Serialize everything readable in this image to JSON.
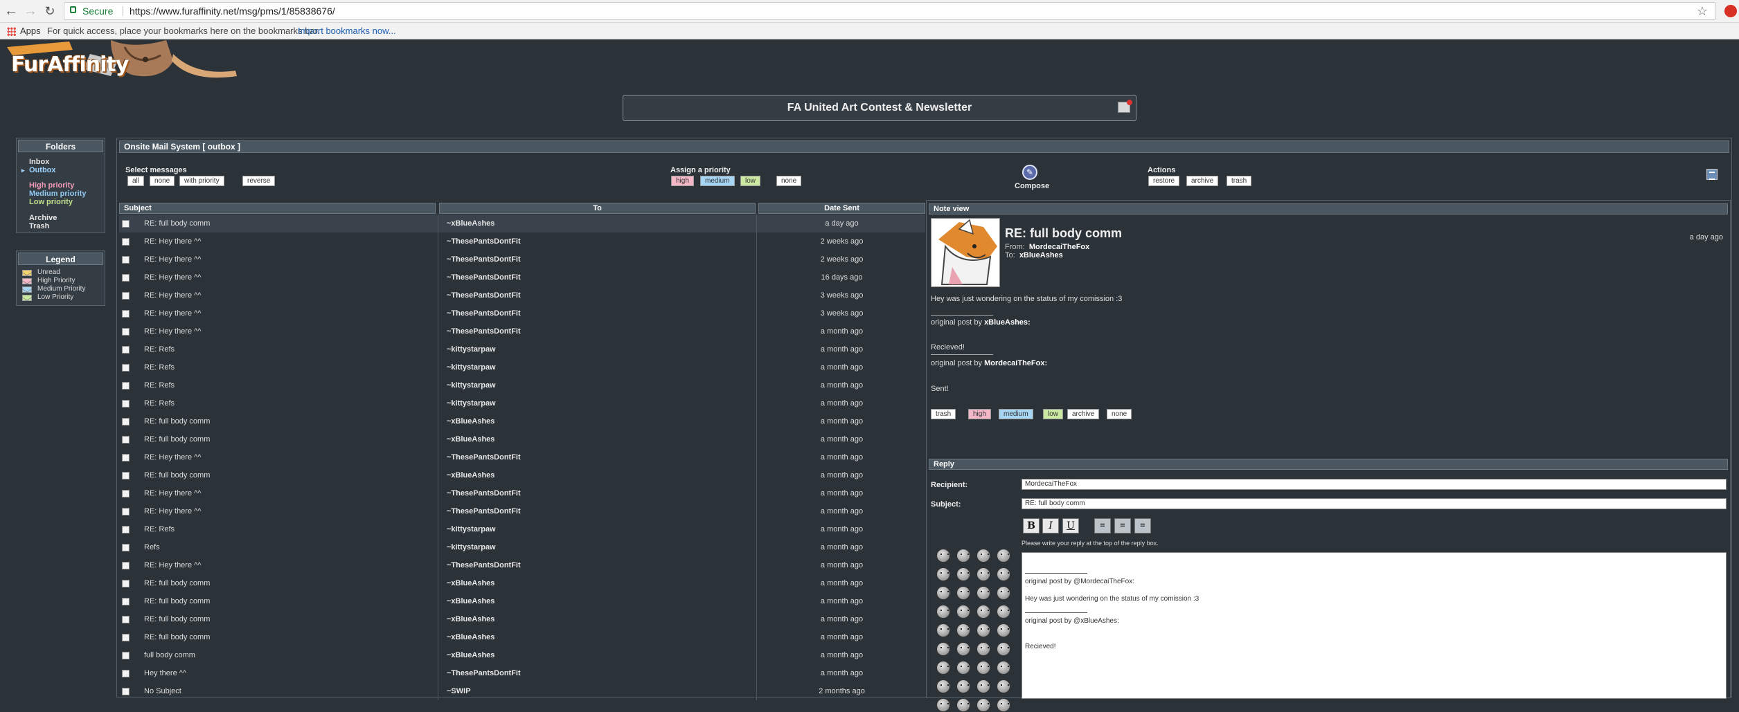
{
  "browser": {
    "secure_label": "Secure",
    "url": "https://www.furaffinity.net/msg/pms/1/85838676/",
    "apps_label": "Apps",
    "bookmarks_hint": "For quick access, place your bookmarks here on the bookmarks bar.",
    "import_link": "Import bookmarks now..."
  },
  "site": {
    "logo_text": "FurAffinity",
    "banner_title": "FA United Art Contest & Newsletter"
  },
  "folders": {
    "title": "Folders",
    "inbox": "Inbox",
    "outbox": "Outbox",
    "high": "High priority",
    "medium": "Medium priority",
    "low": "Low priority",
    "archive": "Archive",
    "trash": "Trash"
  },
  "legend": {
    "title": "Legend",
    "items": [
      "Unread",
      "High Priority",
      "Medium Priority",
      "Low Priority"
    ]
  },
  "mail": {
    "title": "Onsite Mail System [ outbox ]",
    "select_label": "Select messages",
    "select_buttons": [
      "all",
      "none",
      "with priority",
      "reverse"
    ],
    "priority_label": "Assign a priority",
    "priority_buttons": [
      "high",
      "medium",
      "low",
      "none"
    ],
    "actions_label": "Actions",
    "action_buttons": [
      "restore",
      "archive",
      "trash"
    ],
    "compose_label": "Compose",
    "columns": [
      "Subject",
      "To",
      "Date Sent"
    ],
    "messages": [
      {
        "subject": "RE: full body comm",
        "to": "~xBlueAshes",
        "date": "a day ago"
      },
      {
        "subject": "RE: Hey there ^^",
        "to": "~ThesePantsDontFit",
        "date": "2 weeks ago"
      },
      {
        "subject": "RE: Hey there ^^",
        "to": "~ThesePantsDontFit",
        "date": "2 weeks ago"
      },
      {
        "subject": "RE: Hey there ^^",
        "to": "~ThesePantsDontFit",
        "date": "16 days ago"
      },
      {
        "subject": "RE: Hey there ^^",
        "to": "~ThesePantsDontFit",
        "date": "3 weeks ago"
      },
      {
        "subject": "RE: Hey there ^^",
        "to": "~ThesePantsDontFit",
        "date": "3 weeks ago"
      },
      {
        "subject": "RE: Hey there ^^",
        "to": "~ThesePantsDontFit",
        "date": "a month ago"
      },
      {
        "subject": "RE: Refs",
        "to": "~kittystarpaw",
        "date": "a month ago"
      },
      {
        "subject": "RE: Refs",
        "to": "~kittystarpaw",
        "date": "a month ago"
      },
      {
        "subject": "RE: Refs",
        "to": "~kittystarpaw",
        "date": "a month ago"
      },
      {
        "subject": "RE: Refs",
        "to": "~kittystarpaw",
        "date": "a month ago"
      },
      {
        "subject": "RE: full body comm",
        "to": "~xBlueAshes",
        "date": "a month ago"
      },
      {
        "subject": "RE: full body comm",
        "to": "~xBlueAshes",
        "date": "a month ago"
      },
      {
        "subject": "RE: Hey there ^^",
        "to": "~ThesePantsDontFit",
        "date": "a month ago"
      },
      {
        "subject": "RE: full body comm",
        "to": "~xBlueAshes",
        "date": "a month ago"
      },
      {
        "subject": "RE: Hey there ^^",
        "to": "~ThesePantsDontFit",
        "date": "a month ago"
      },
      {
        "subject": "RE: Hey there ^^",
        "to": "~ThesePantsDontFit",
        "date": "a month ago"
      },
      {
        "subject": "RE: Refs",
        "to": "~kittystarpaw",
        "date": "a month ago"
      },
      {
        "subject": "Refs",
        "to": "~kittystarpaw",
        "date": "a month ago"
      },
      {
        "subject": "RE: Hey there ^^",
        "to": "~ThesePantsDontFit",
        "date": "a month ago"
      },
      {
        "subject": "RE: full body comm",
        "to": "~xBlueAshes",
        "date": "a month ago"
      },
      {
        "subject": "RE: full body comm",
        "to": "~xBlueAshes",
        "date": "a month ago"
      },
      {
        "subject": "RE: full body comm",
        "to": "~xBlueAshes",
        "date": "a month ago"
      },
      {
        "subject": "RE: full body comm",
        "to": "~xBlueAshes",
        "date": "a month ago"
      },
      {
        "subject": "full body comm",
        "to": "~xBlueAshes",
        "date": "a month ago"
      },
      {
        "subject": "Hey there ^^",
        "to": "~ThesePantsDontFit",
        "date": "a month ago"
      },
      {
        "subject": "No Subject",
        "to": "~SWIP",
        "date": "2 months ago"
      }
    ]
  },
  "note": {
    "header": "Note view",
    "subject": "RE: full body comm",
    "from_label": "From:",
    "from": "MordecaiTheFox",
    "to_label": "To:",
    "to": "xBlueAshes",
    "date": "a day ago",
    "body_line1": "Hey was just wondering on the status of my comission :3",
    "quote1_prefix": "original post by",
    "quote1_author": "xBlueAshes:",
    "body_line2": "Recieved!",
    "quote2_prefix": "original post by",
    "quote2_author": "MordecaiTheFox:",
    "body_line3": "Sent!",
    "action_buttons": [
      "trash",
      "high",
      "medium",
      "low",
      "archive",
      "none"
    ]
  },
  "reply": {
    "header": "Reply",
    "recipient_label": "Recipient:",
    "recipient_value": "MordecaiTheFox",
    "subject_label": "Subject:",
    "subject_value": "RE: full body comm",
    "format_bold": "B",
    "format_italic": "I",
    "format_underline": "U",
    "hint": "Please write your reply at the top of the reply box.",
    "body": {
      "line1": "original post by @MordecaiTheFox:",
      "line2": "Hey was just wondering on the status of my comission :3",
      "line3": "original post by @xBlueAshes:",
      "line4": "Recieved!"
    }
  }
}
